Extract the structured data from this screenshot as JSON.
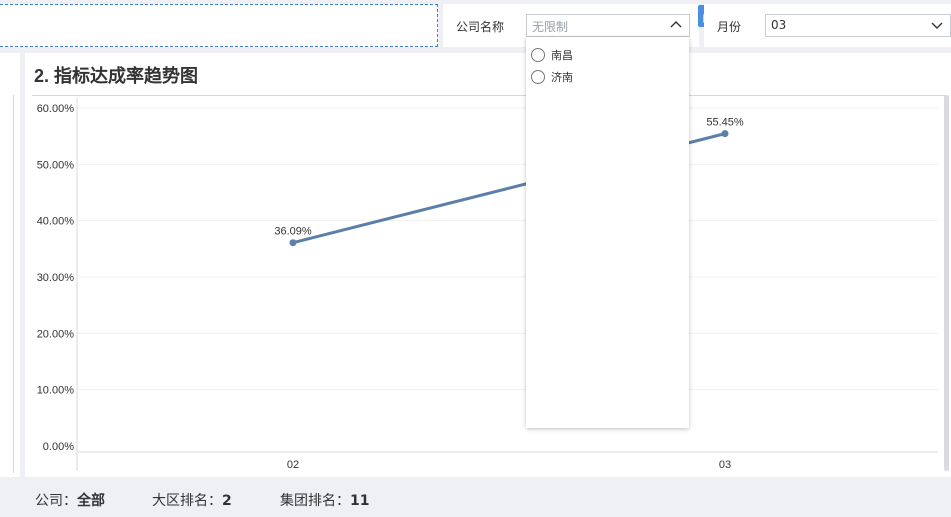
{
  "filters": {
    "company_label": "公司名称",
    "company_placeholder": "无限制",
    "month_label": "月份",
    "month_value": "03"
  },
  "dropdown": {
    "options": [
      "南昌",
      "济南"
    ]
  },
  "chart_title": "2. 指标达成率趋势图",
  "chart_data": {
    "type": "line",
    "categories": [
      "02",
      "03"
    ],
    "series": [
      {
        "values": [
          36.09,
          55.45
        ],
        "labels": [
          "36.09%",
          "55.45%"
        ]
      }
    ],
    "ylim": [
      0,
      60
    ],
    "yticks": [
      0,
      10,
      20,
      30,
      40,
      50,
      60
    ],
    "ytick_labels": [
      "0.00%",
      "10.00%",
      "20.00%",
      "30.00%",
      "40.00%",
      "50.00%",
      "60.00%"
    ],
    "grid": true,
    "colors": {
      "line": "#5b7fa8",
      "grid": "#eef0f3"
    }
  },
  "footer": {
    "company_label": "公司：",
    "company_value": "全部",
    "region_rank_label": "大区排名：",
    "region_rank_value": "2",
    "group_rank_label": "集团排名：",
    "group_rank_value": "11"
  }
}
